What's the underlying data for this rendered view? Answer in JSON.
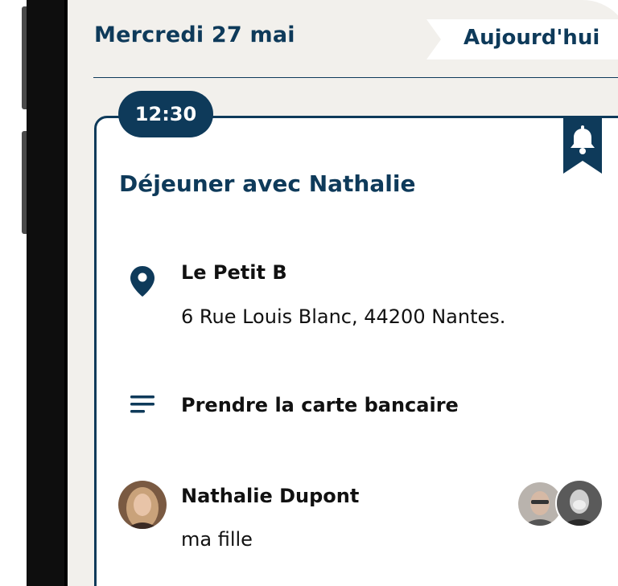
{
  "header": {
    "date": "Mercredi 27 mai",
    "today_button": "Aujourd'hui"
  },
  "event": {
    "time": "12:30",
    "title": "Déjeuner avec Nathalie",
    "reminder_icon": "bell-icon",
    "location": {
      "icon": "location-pin-icon",
      "name": "Le Petit B",
      "address": "6 Rue Louis Blanc, 44200 Nantes."
    },
    "note": {
      "icon": "notes-icon",
      "text": "Prendre la carte bancaire"
    },
    "contact": {
      "name": "Nathalie Dupont",
      "relation": "ma fille"
    }
  },
  "colors": {
    "primary": "#0e3a5a",
    "background": "#f2f0ec",
    "card": "#ffffff"
  }
}
